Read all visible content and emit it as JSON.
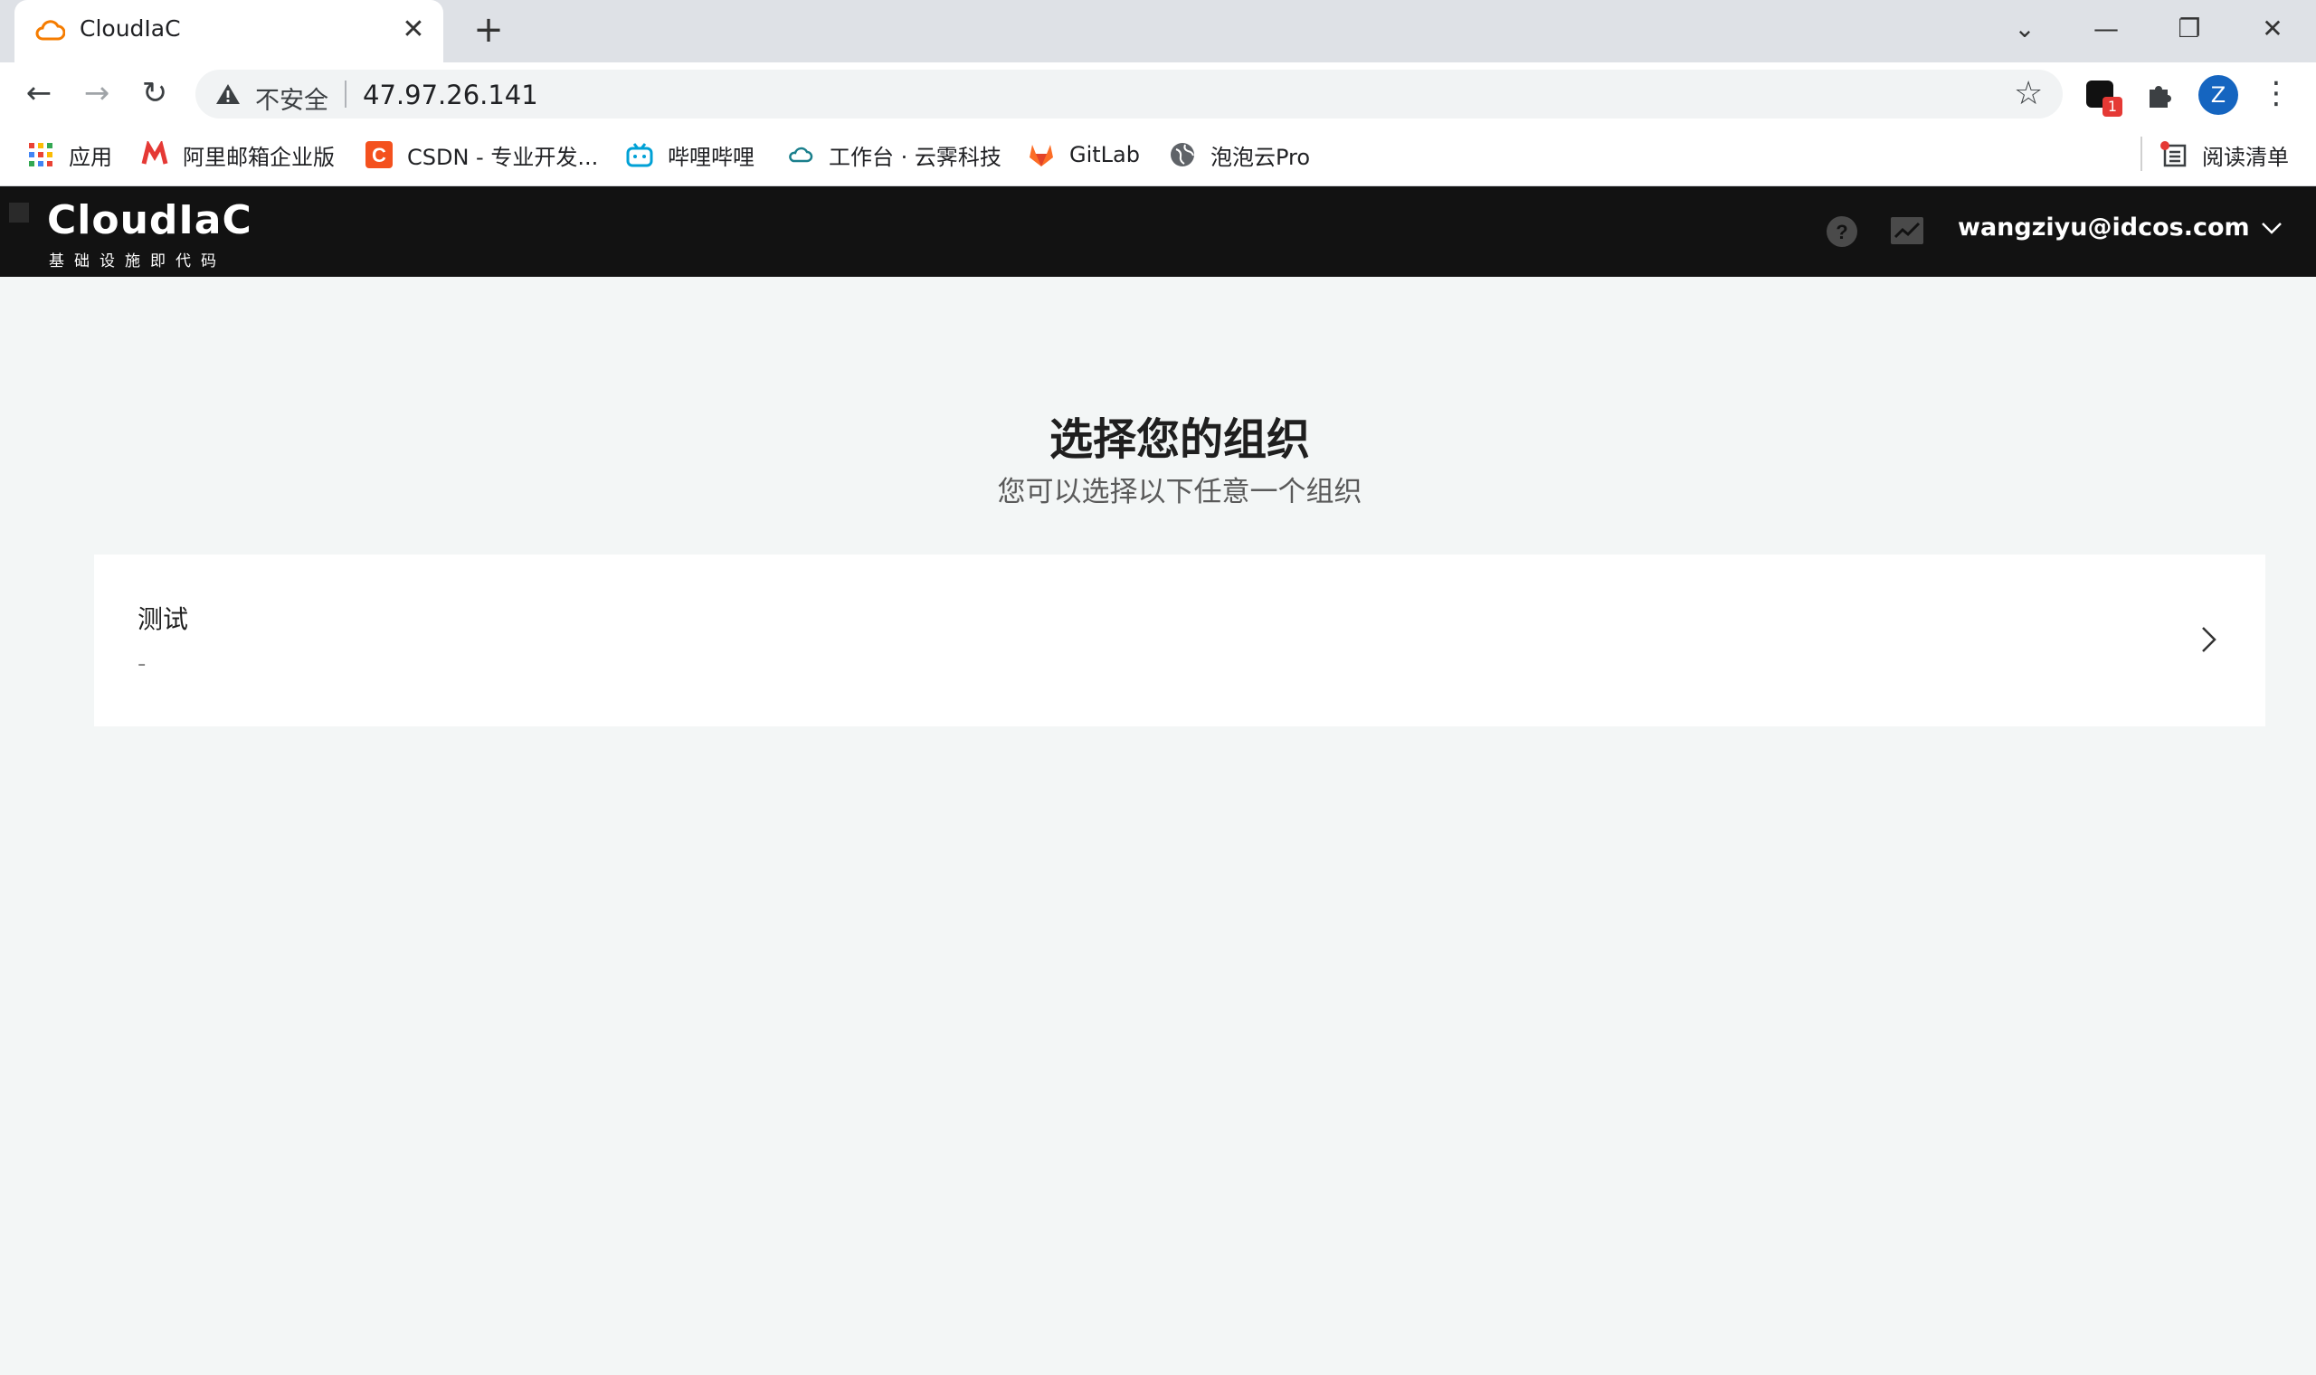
{
  "browser": {
    "tab_title": "CloudIaC",
    "tab_close": "✕",
    "new_tab": "+",
    "window_controls": {
      "chevron": "⌄",
      "minimize": "—",
      "restore": "❐",
      "close": "✕"
    },
    "nav": {
      "back": "←",
      "forward": "→",
      "reload": "↻"
    },
    "security_label": "不安全",
    "url": "47.97.26.141",
    "bookmark_star": "☆",
    "extension_badge": "1",
    "profile_initial": "Z",
    "menu": "⋮",
    "bookmarks": [
      {
        "label": "应用",
        "icon": "apps-grid-icon"
      },
      {
        "label": "阿里邮箱企业版",
        "icon": "aliyun-mail-icon"
      },
      {
        "label": "CSDN - 专业开发...",
        "icon": "csdn-icon"
      },
      {
        "label": "哔哩哔哩",
        "icon": "bilibili-icon"
      },
      {
        "label": "工作台 · 云霁科技",
        "icon": "cloud-icon"
      },
      {
        "label": "GitLab",
        "icon": "gitlab-icon"
      },
      {
        "label": "泡泡云Pro",
        "icon": "globe-icon"
      }
    ],
    "reading_list": "阅读清单"
  },
  "app": {
    "logo_title": "CloudIaC",
    "logo_subtitle": "基础设施即代码",
    "user_email": "wangziyu@idcos.com"
  },
  "main": {
    "title": "选择您的组织",
    "subtitle": "您可以选择以下任意一个组织",
    "organizations": [
      {
        "name": "测试",
        "description": "-"
      }
    ]
  },
  "colors": {
    "header_bg": "#121212",
    "page_bg": "#f3f6f6",
    "card_bg": "#ffffff",
    "avatar_bg": "#1565c0",
    "badge_bg": "#e53935"
  }
}
